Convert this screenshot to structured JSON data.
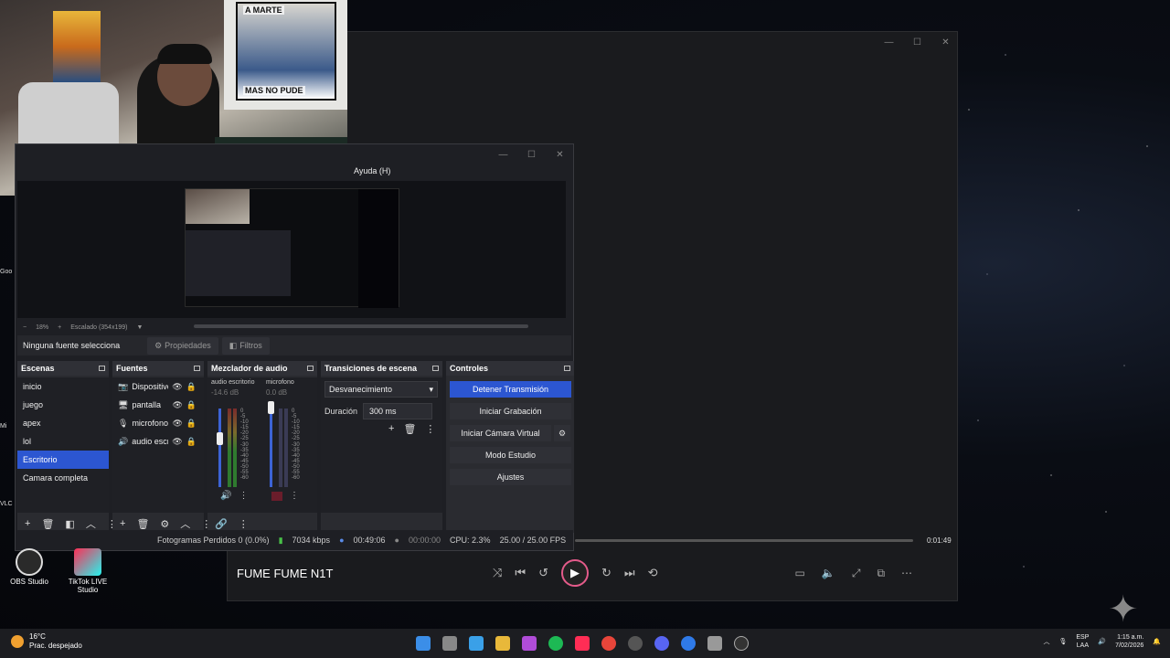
{
  "media_player": {
    "track_title": "FUME FUME N1T",
    "elapsed_time": "0:01:49"
  },
  "obs": {
    "menu_help": "Ayuda (H)",
    "zoom_level": "18%",
    "scale_label": "Escalado (354x199)",
    "no_source": "Ninguna fuente selecciona",
    "properties_btn": "Propiedades",
    "filters_btn": "Filtros",
    "scenes": {
      "title": "Escenas",
      "items": [
        "inicio",
        "juego",
        "apex",
        "lol",
        "Escritorio",
        "Camara completa"
      ],
      "selected": "Escritorio"
    },
    "sources": {
      "title": "Fuentes",
      "items": [
        "Dispositivo",
        "pantalla",
        "microfono",
        "audio escritorio"
      ]
    },
    "mixer": {
      "title": "Mezclador de audio",
      "channels": [
        {
          "name": "audio escritorio",
          "db": "-14.6 dB"
        },
        {
          "name": "microfono",
          "db": "0.0 dB"
        }
      ],
      "scale": [
        "0",
        "-5",
        "-10",
        "-15",
        "-20",
        "-25",
        "-30",
        "-35",
        "-40",
        "-45",
        "-50",
        "-55",
        "-60"
      ]
    },
    "transitions": {
      "title": "Transiciones de escena",
      "selected": "Desvanecimiento",
      "duration_label": "Duración",
      "duration_value": "300 ms"
    },
    "controls": {
      "title": "Controles",
      "stop_stream": "Detener Transmisión",
      "start_recording": "Iniciar Grabación",
      "start_virtual_cam": "Iniciar Cámara Virtual",
      "studio_mode": "Modo Estudio",
      "settings": "Ajustes"
    },
    "status": {
      "dropped_frames": "Fotogramas Perdidos 0 (0.0%)",
      "bitrate": "7034 kbps",
      "stream_time": "00:49:06",
      "rec_time": "00:00:00",
      "cpu": "CPU: 2.3%",
      "fps": "25.00 / 25.00 FPS"
    }
  },
  "desktop": {
    "icons": [
      {
        "label": "OBS Studio"
      },
      {
        "label": "TikTok LIVE Studio"
      }
    ],
    "side_labels": [
      "Goo",
      "Mi",
      "VLC"
    ]
  },
  "webcam": {
    "poster_top": "A MARTE",
    "poster_bottom": "MAS NO PUDE"
  },
  "taskbar": {
    "temperature": "16°C",
    "weather": "Prac. despejado",
    "lang_top": "ESP",
    "lang_bottom": "LAA",
    "time": "1:15 a.m.",
    "date": "7/02/2026"
  }
}
